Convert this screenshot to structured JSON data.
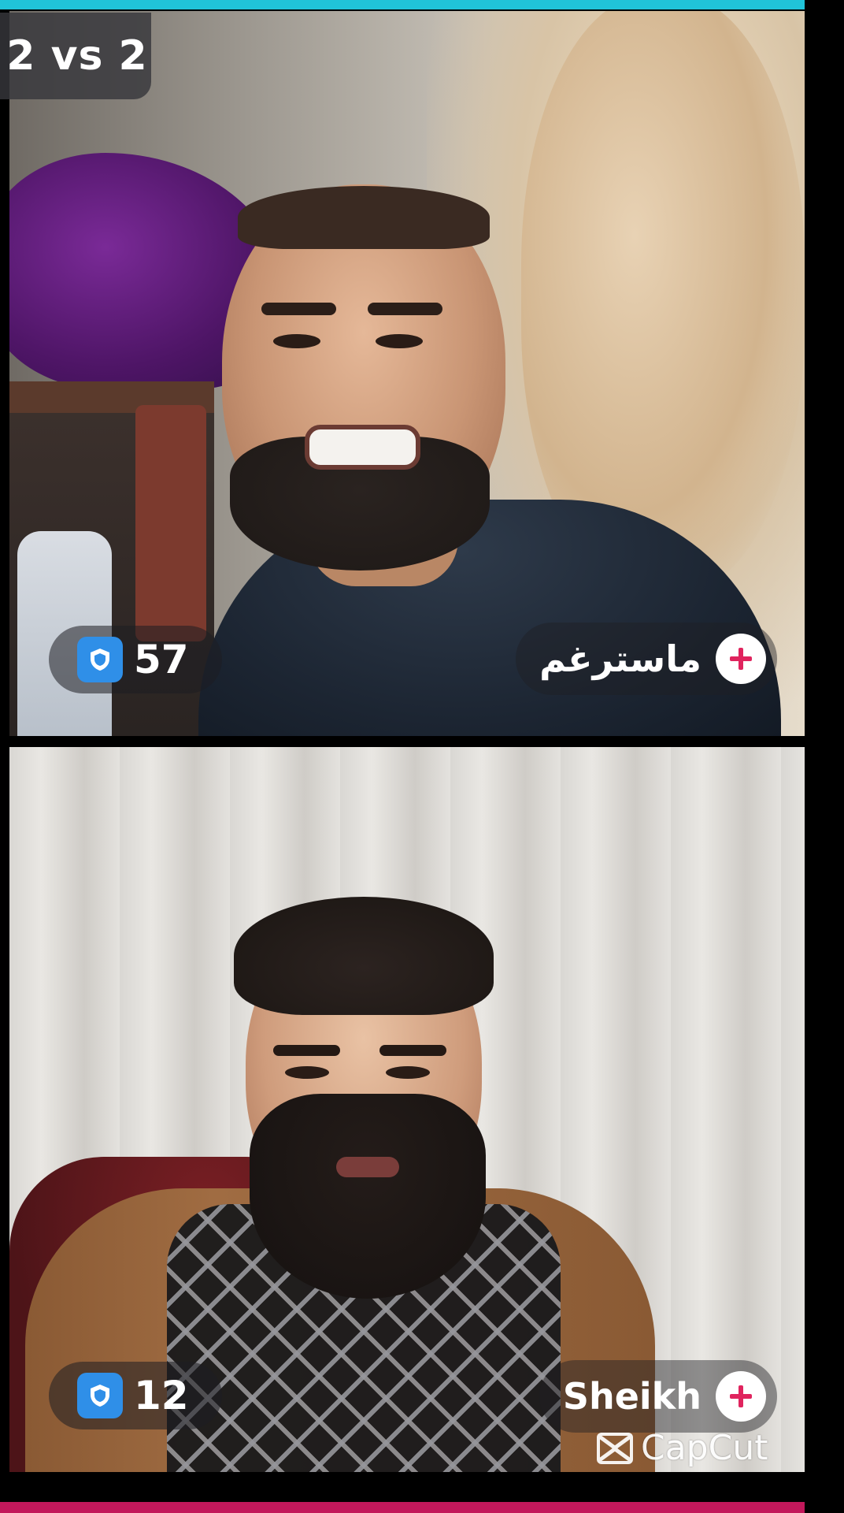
{
  "battle": {
    "mode_label": "2 vs 2"
  },
  "participants": [
    {
      "viewer_count": "57",
      "name": "ماسترغم"
    },
    {
      "viewer_count": "12",
      "name": "Sheikh"
    }
  ],
  "watermark": {
    "text": "CapCut"
  },
  "colors": {
    "top_accent": "#20c3d8",
    "bottom_accent": "#c2185b",
    "viewer_icon": "#2f8fe8",
    "plus_icon": "#e0245e"
  }
}
